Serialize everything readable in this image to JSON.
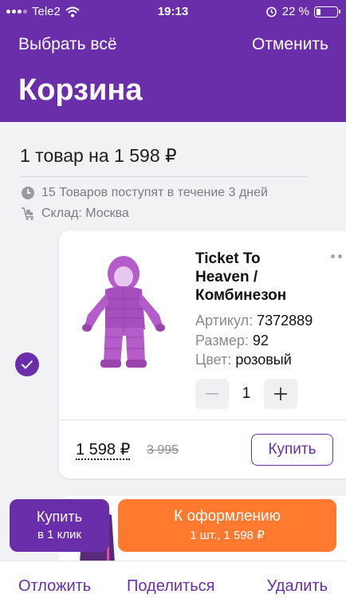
{
  "status": {
    "carrier": "Tele2",
    "time": "19:13",
    "battery": "22 %",
    "battery_level": 0.22
  },
  "header": {
    "select_all": "Выбрать всё",
    "cancel": "Отменить",
    "title": "Корзина"
  },
  "summary": {
    "text": "1 товар на 1 598 ₽",
    "delivery": "15 Товаров поступят в течение 3 дней",
    "warehouse": "Склад: Москва"
  },
  "item": {
    "title": "Ticket To Heaven / Комбинезон",
    "article_label": "Артикул:",
    "article": "7372889",
    "size_label": "Размер:",
    "size": "92",
    "color_label": "Цвет:",
    "color": "розовый",
    "quantity": "1",
    "price": "1 598 ₽",
    "old_price": "3 995",
    "buy": "Купить",
    "selected": true
  },
  "actions": {
    "one_click_l1": "Купить",
    "one_click_l2": "в 1 клик",
    "checkout_l1": "К оформлению",
    "checkout_l2": "1 шт., 1 598 ₽"
  },
  "bottom": {
    "postpone": "Отложить",
    "share": "Поделиться",
    "delete": "Удалить"
  },
  "colors": {
    "accent": "#6a2eaa",
    "orange": "#ff7a2f"
  },
  "icons": [
    "wifi-icon",
    "alarm-icon",
    "battery-icon",
    "clock-icon",
    "warehouse-icon",
    "check-icon",
    "more-icon",
    "minus-icon",
    "plus-icon"
  ]
}
